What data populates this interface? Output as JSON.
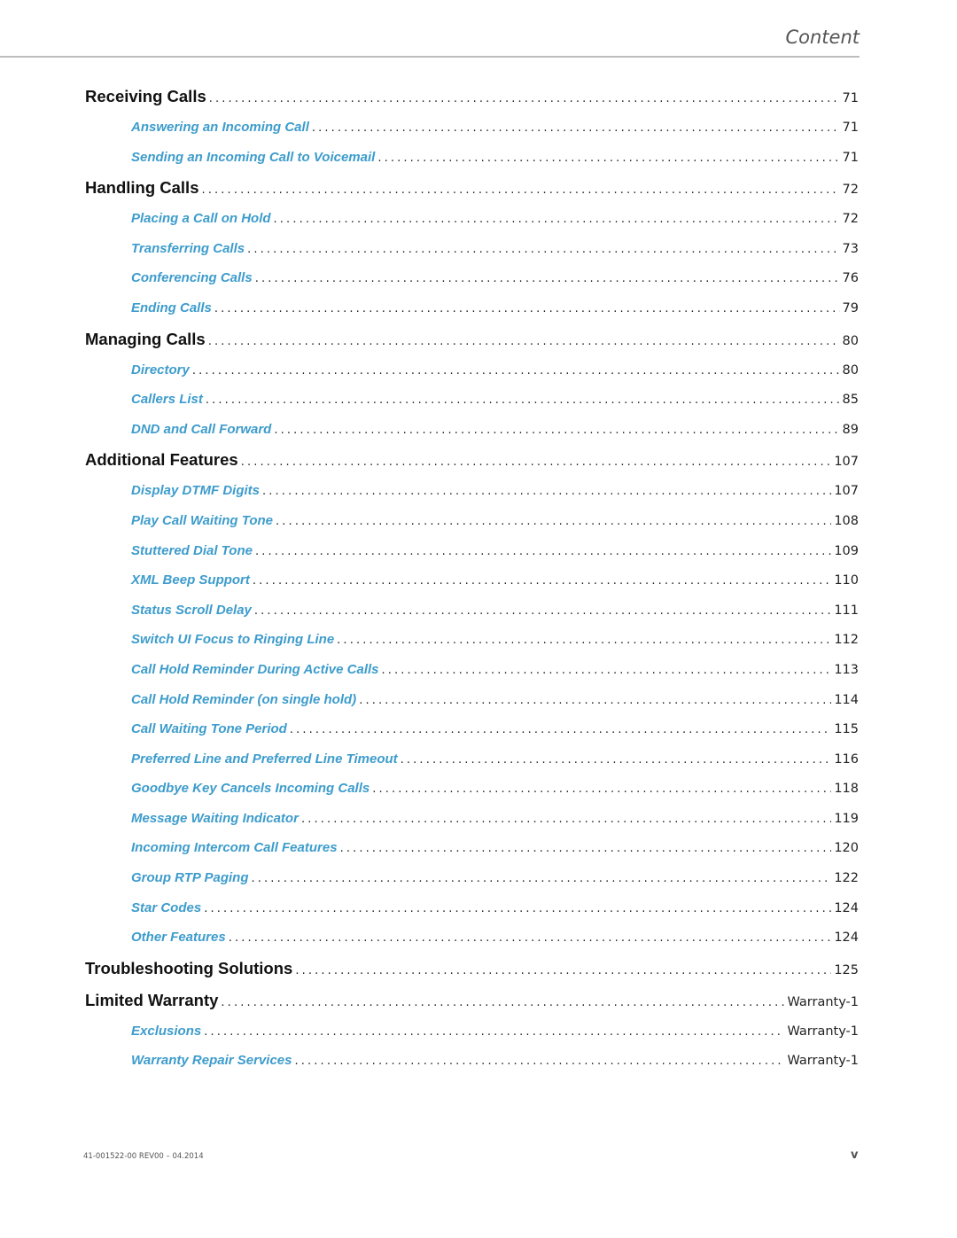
{
  "header": {
    "title": "Content"
  },
  "toc": {
    "sections": [
      {
        "title": "Receiving Calls",
        "page": "71",
        "items": [
          {
            "title": "Answering an Incoming Call",
            "page": "71"
          },
          {
            "title": "Sending an Incoming Call to Voicemail",
            "page": "71"
          }
        ]
      },
      {
        "title": "Handling Calls",
        "page": "72",
        "items": [
          {
            "title": "Placing a Call on Hold",
            "page": "72"
          },
          {
            "title": "Transferring Calls",
            "page": "73"
          },
          {
            "title": "Conferencing Calls",
            "page": "76"
          },
          {
            "title": "Ending Calls",
            "page": "79"
          }
        ]
      },
      {
        "title": "Managing Calls",
        "page": "80",
        "items": [
          {
            "title": "Directory",
            "page": "80"
          },
          {
            "title": "Callers List",
            "page": "85"
          },
          {
            "title": "DND and Call Forward",
            "page": "89"
          }
        ]
      },
      {
        "title": "Additional Features",
        "page": "107",
        "items": [
          {
            "title": "Display DTMF Digits",
            "page": "107"
          },
          {
            "title": "Play Call Waiting Tone",
            "page": "108"
          },
          {
            "title": "Stuttered Dial Tone",
            "page": "109"
          },
          {
            "title": "XML Beep Support",
            "page": "110"
          },
          {
            "title": "Status Scroll Delay",
            "page": "111"
          },
          {
            "title": "Switch UI Focus to Ringing Line",
            "page": "112"
          },
          {
            "title": "Call Hold Reminder During Active Calls",
            "page": "113"
          },
          {
            "title": "Call Hold Reminder (on single hold)",
            "page": "114"
          },
          {
            "title": "Call Waiting Tone Period",
            "page": "115"
          },
          {
            "title": "Preferred Line and Preferred Line Timeout",
            "page": "116"
          },
          {
            "title": "Goodbye Key Cancels Incoming Calls",
            "page": "118"
          },
          {
            "title": "Message Waiting Indicator",
            "page": "119"
          },
          {
            "title": "Incoming Intercom Call Features",
            "page": "120"
          },
          {
            "title": "Group RTP Paging",
            "page": "122"
          },
          {
            "title": "Star Codes",
            "page": "124"
          },
          {
            "title": "Other Features",
            "page": "124"
          }
        ]
      },
      {
        "title": "Troubleshooting Solutions",
        "page": "125",
        "items": []
      },
      {
        "title": "Limited Warranty",
        "page": "Warranty-1",
        "items": [
          {
            "title": "Exclusions",
            "page": "Warranty-1"
          },
          {
            "title": "Warranty Repair Services",
            "page": "Warranty-1"
          }
        ]
      }
    ]
  },
  "footer": {
    "document_id": "41-001522-00 REV00 – 04.2014",
    "page_number": "v"
  },
  "colors": {
    "section_text": "#111111",
    "subsection_link": "#3d9ccc",
    "header_text": "#555555",
    "rule": "#bdbdbd"
  }
}
